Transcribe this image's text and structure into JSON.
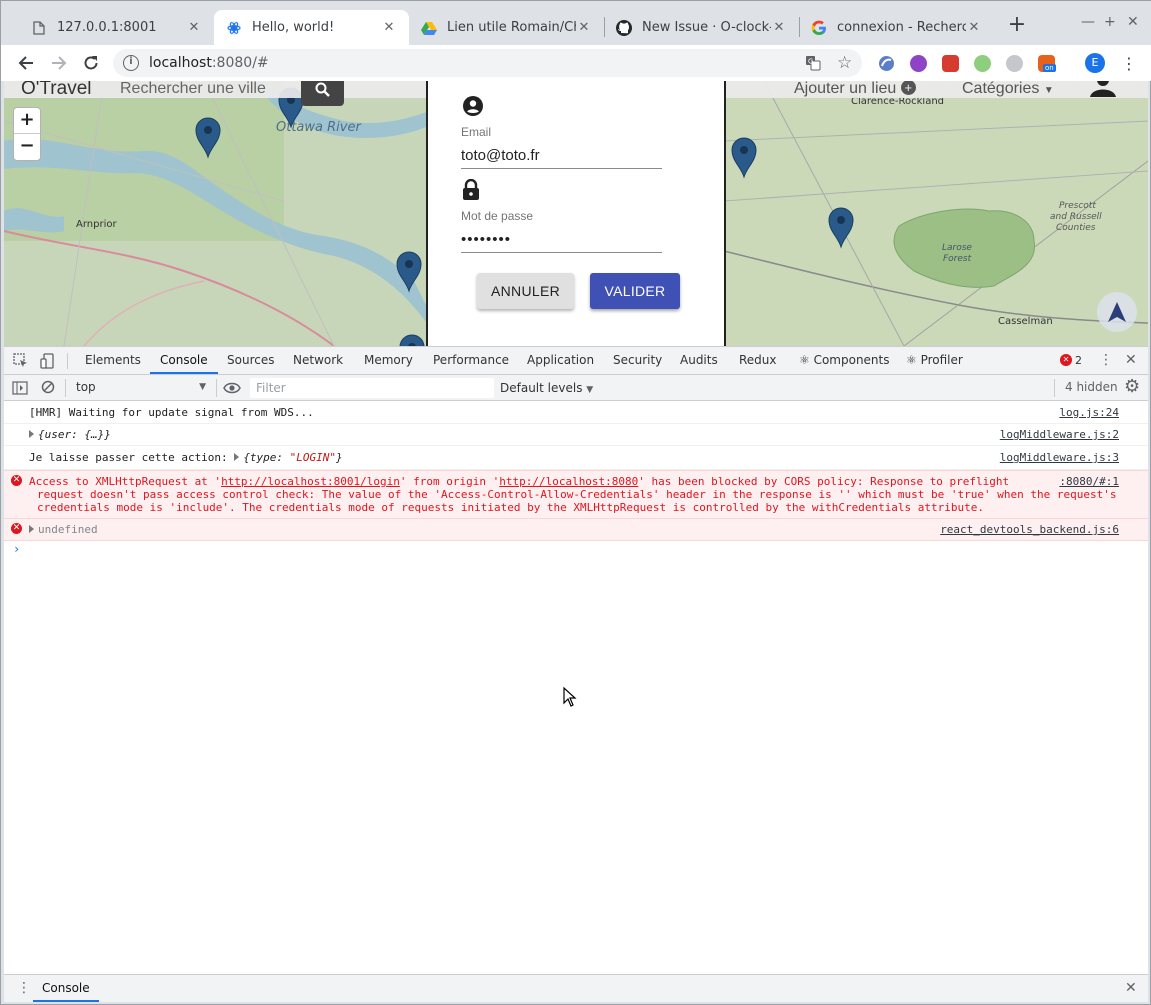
{
  "browser": {
    "tabs": [
      {
        "title": "127.0.0.1:8001",
        "favicon": "page-icon"
      },
      {
        "title": "Hello, world!",
        "favicon": "react-icon",
        "active": true
      },
      {
        "title": "Lien utile Romain/Charl",
        "favicon": "google-drive-icon"
      },
      {
        "title": "New Issue · O-clock-Asc",
        "favicon": "github-icon"
      },
      {
        "title": "connexion - Recherche",
        "favicon": "google-icon"
      }
    ],
    "url_host": "localhost",
    "url_rest": ":8080/#",
    "extension_badge": "on",
    "profile_initial": "E"
  },
  "app": {
    "brand": "O'Travel",
    "search_placeholder": "Rechercher une ville",
    "add_place": "Ajouter un lieu",
    "categories": "Catégories",
    "zoom_in": "+",
    "zoom_out": "−"
  },
  "map": {
    "labels": {
      "ottawa_river": "Ottawa River",
      "arnprior": "Arnprior",
      "clarence": "Clarence-Rockland",
      "prescott_1": "Prescott",
      "prescott_2": "and Russell",
      "prescott_3": "Counties",
      "larose_1": "Larose",
      "larose_2": "Forest",
      "casselman": "Casselman"
    }
  },
  "login_modal": {
    "email_label": "Email",
    "email_value": "toto@toto.fr",
    "password_label": "Mot de passe",
    "password_value": "••••••••",
    "cancel_label": "ANNULER",
    "submit_label": "VALIDER"
  },
  "devtools": {
    "tabs": [
      "Elements",
      "Console",
      "Sources",
      "Network",
      "Memory",
      "Performance",
      "Application",
      "Security",
      "Audits",
      "Redux",
      "⚛ Components",
      "⚛ Profiler"
    ],
    "active_tab": "Console",
    "error_count": "2",
    "context": "top",
    "filter_placeholder": "Filter",
    "levels": "Default levels",
    "hidden": "4 hidden",
    "drawer_tab": "Console",
    "console": [
      {
        "type": "log",
        "text": "[HMR] Waiting for update signal from WDS...",
        "source": "log.js:24"
      },
      {
        "type": "log",
        "text": "{user: {…}}",
        "source": "logMiddleware.js:2"
      },
      {
        "type": "log",
        "text": "Je laisse passer cette action:  ",
        "obj_prefix": "{type: ",
        "obj_value": "\"LOGIN\"",
        "obj_suffix": "}",
        "source": "logMiddleware.js:3"
      },
      {
        "type": "error",
        "p1": "Access to XMLHttpRequest at '",
        "link1": "http://localhost:8001/login",
        "p2": "' from origin '",
        "link2": "http://localhost:8080",
        "p3": "' has been blocked by CORS policy: Response to preflight",
        "line2": "request doesn't pass access control check: The value of the 'Access-Control-Allow-Credentials' header in the response is '' which must be 'true' when the request's",
        "line3": "credentials mode is 'include'. The credentials mode of requests initiated by the XMLHttpRequest is controlled by the withCredentials attribute.",
        "source": ":8080/#:1"
      },
      {
        "type": "error",
        "text": "undefined",
        "source": "react_devtools_backend.js:6"
      }
    ]
  }
}
